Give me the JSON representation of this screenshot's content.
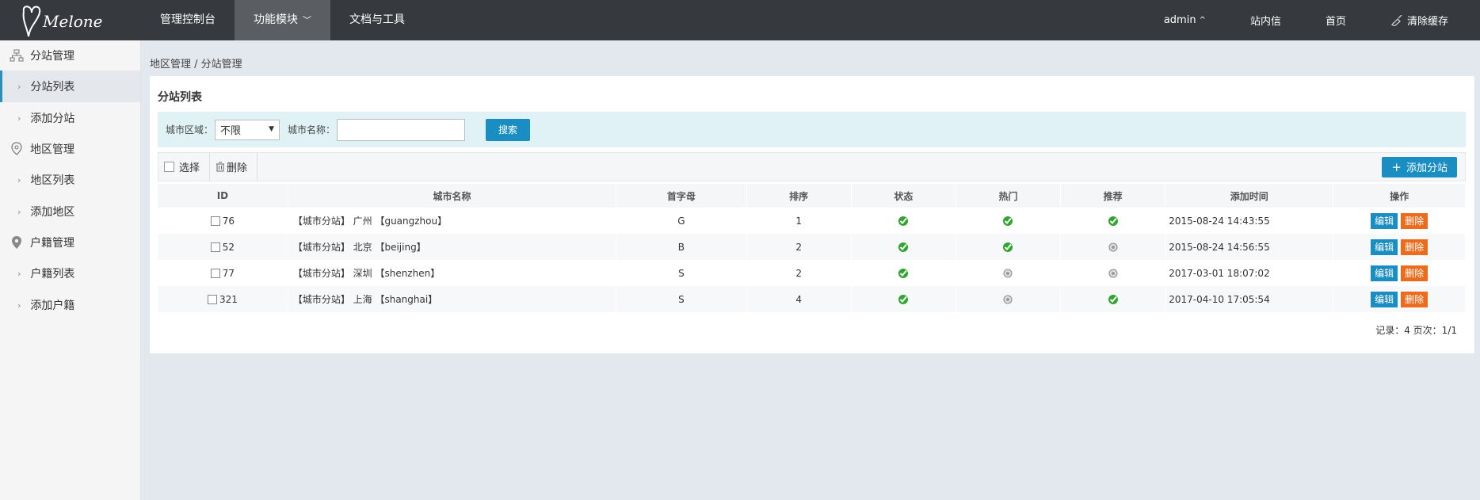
{
  "topbar": {
    "logo_text": "Melone",
    "nav": [
      {
        "label": "管理控制台",
        "active": false
      },
      {
        "label": "功能模块",
        "active": true
      },
      {
        "label": "文档与工具",
        "active": false
      }
    ],
    "user": "admin",
    "messages": "站内信",
    "home": "首页",
    "clear_cache": "清除缓存"
  },
  "sidebar": {
    "groups": [
      {
        "label": "分站管理",
        "icon": "sitemap-icon",
        "items": [
          {
            "label": "分站列表",
            "active": true
          },
          {
            "label": "添加分站",
            "active": false
          }
        ]
      },
      {
        "label": "地区管理",
        "icon": "map-pin-icon",
        "items": [
          {
            "label": "地区列表",
            "active": false
          },
          {
            "label": "添加地区",
            "active": false
          }
        ]
      },
      {
        "label": "户籍管理",
        "icon": "location-icon",
        "items": [
          {
            "label": "户籍列表",
            "active": false
          },
          {
            "label": "添加户籍",
            "active": false
          }
        ]
      }
    ]
  },
  "breadcrumb": "地区管理 / 分站管理",
  "panel": {
    "title": "分站列表",
    "search": {
      "region_label": "城市区域：",
      "region_value": "不限",
      "name_label": "城市名称：",
      "name_value": "",
      "search_button": "搜索"
    },
    "toolbar": {
      "select_label": "选择",
      "delete_label": "删除",
      "add_label": "添加分站"
    },
    "table": {
      "headers": [
        "ID",
        "城市名称",
        "首字母",
        "排序",
        "状态",
        "热门",
        "推荐",
        "添加时间",
        "操作"
      ],
      "rows": [
        {
          "id": "76",
          "name": "【城市分站】 广州 【guangzhou】",
          "letter": "G",
          "order": "1",
          "status": true,
          "hot": true,
          "recommend": true,
          "time": "2015-08-24 14:43:55"
        },
        {
          "id": "52",
          "name": "【城市分站】 北京 【beijing】",
          "letter": "B",
          "order": "2",
          "status": true,
          "hot": true,
          "recommend": false,
          "time": "2015-08-24 14:56:55"
        },
        {
          "id": "77",
          "name": "【城市分站】 深圳 【shenzhen】",
          "letter": "S",
          "order": "2",
          "status": true,
          "hot": false,
          "recommend": false,
          "time": "2017-03-01 18:07:02"
        },
        {
          "id": "321",
          "name": "【城市分站】 上海 【shanghai】",
          "letter": "S",
          "order": "4",
          "status": true,
          "hot": false,
          "recommend": true,
          "time": "2017-04-10 17:05:54"
        }
      ],
      "edit_label": "编辑",
      "delete_label": "删除"
    },
    "pager": "记录：4  页次：1/1"
  },
  "colors": {
    "accent": "#1a8ec2",
    "danger": "#ec6b1d",
    "topbar": "#36393d",
    "check": "#2fa52f"
  }
}
